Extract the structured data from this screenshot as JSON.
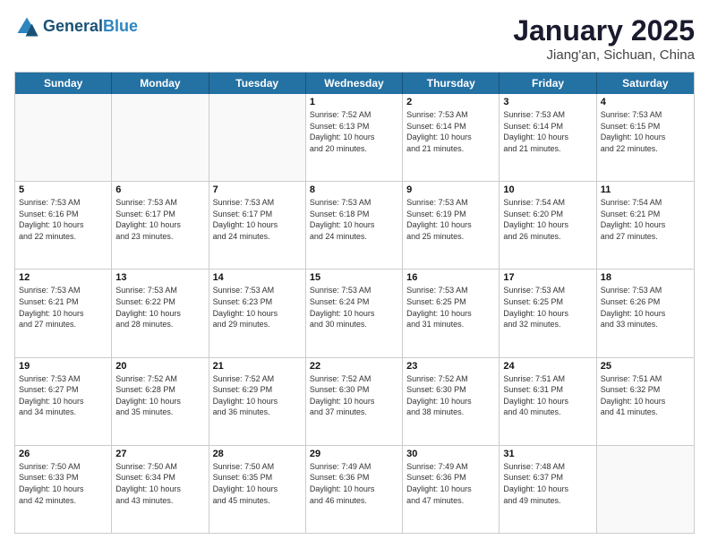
{
  "header": {
    "logo_general": "General",
    "logo_blue": "Blue",
    "title": "January 2025",
    "location": "Jiang'an, Sichuan, China"
  },
  "dayHeaders": [
    "Sunday",
    "Monday",
    "Tuesday",
    "Wednesday",
    "Thursday",
    "Friday",
    "Saturday"
  ],
  "weeks": [
    [
      {
        "day": "",
        "info": ""
      },
      {
        "day": "",
        "info": ""
      },
      {
        "day": "",
        "info": ""
      },
      {
        "day": "1",
        "info": "Sunrise: 7:52 AM\nSunset: 6:13 PM\nDaylight: 10 hours\nand 20 minutes."
      },
      {
        "day": "2",
        "info": "Sunrise: 7:53 AM\nSunset: 6:14 PM\nDaylight: 10 hours\nand 21 minutes."
      },
      {
        "day": "3",
        "info": "Sunrise: 7:53 AM\nSunset: 6:14 PM\nDaylight: 10 hours\nand 21 minutes."
      },
      {
        "day": "4",
        "info": "Sunrise: 7:53 AM\nSunset: 6:15 PM\nDaylight: 10 hours\nand 22 minutes."
      }
    ],
    [
      {
        "day": "5",
        "info": "Sunrise: 7:53 AM\nSunset: 6:16 PM\nDaylight: 10 hours\nand 22 minutes."
      },
      {
        "day": "6",
        "info": "Sunrise: 7:53 AM\nSunset: 6:17 PM\nDaylight: 10 hours\nand 23 minutes."
      },
      {
        "day": "7",
        "info": "Sunrise: 7:53 AM\nSunset: 6:17 PM\nDaylight: 10 hours\nand 24 minutes."
      },
      {
        "day": "8",
        "info": "Sunrise: 7:53 AM\nSunset: 6:18 PM\nDaylight: 10 hours\nand 24 minutes."
      },
      {
        "day": "9",
        "info": "Sunrise: 7:53 AM\nSunset: 6:19 PM\nDaylight: 10 hours\nand 25 minutes."
      },
      {
        "day": "10",
        "info": "Sunrise: 7:54 AM\nSunset: 6:20 PM\nDaylight: 10 hours\nand 26 minutes."
      },
      {
        "day": "11",
        "info": "Sunrise: 7:54 AM\nSunset: 6:21 PM\nDaylight: 10 hours\nand 27 minutes."
      }
    ],
    [
      {
        "day": "12",
        "info": "Sunrise: 7:53 AM\nSunset: 6:21 PM\nDaylight: 10 hours\nand 27 minutes."
      },
      {
        "day": "13",
        "info": "Sunrise: 7:53 AM\nSunset: 6:22 PM\nDaylight: 10 hours\nand 28 minutes."
      },
      {
        "day": "14",
        "info": "Sunrise: 7:53 AM\nSunset: 6:23 PM\nDaylight: 10 hours\nand 29 minutes."
      },
      {
        "day": "15",
        "info": "Sunrise: 7:53 AM\nSunset: 6:24 PM\nDaylight: 10 hours\nand 30 minutes."
      },
      {
        "day": "16",
        "info": "Sunrise: 7:53 AM\nSunset: 6:25 PM\nDaylight: 10 hours\nand 31 minutes."
      },
      {
        "day": "17",
        "info": "Sunrise: 7:53 AM\nSunset: 6:25 PM\nDaylight: 10 hours\nand 32 minutes."
      },
      {
        "day": "18",
        "info": "Sunrise: 7:53 AM\nSunset: 6:26 PM\nDaylight: 10 hours\nand 33 minutes."
      }
    ],
    [
      {
        "day": "19",
        "info": "Sunrise: 7:53 AM\nSunset: 6:27 PM\nDaylight: 10 hours\nand 34 minutes."
      },
      {
        "day": "20",
        "info": "Sunrise: 7:52 AM\nSunset: 6:28 PM\nDaylight: 10 hours\nand 35 minutes."
      },
      {
        "day": "21",
        "info": "Sunrise: 7:52 AM\nSunset: 6:29 PM\nDaylight: 10 hours\nand 36 minutes."
      },
      {
        "day": "22",
        "info": "Sunrise: 7:52 AM\nSunset: 6:30 PM\nDaylight: 10 hours\nand 37 minutes."
      },
      {
        "day": "23",
        "info": "Sunrise: 7:52 AM\nSunset: 6:30 PM\nDaylight: 10 hours\nand 38 minutes."
      },
      {
        "day": "24",
        "info": "Sunrise: 7:51 AM\nSunset: 6:31 PM\nDaylight: 10 hours\nand 40 minutes."
      },
      {
        "day": "25",
        "info": "Sunrise: 7:51 AM\nSunset: 6:32 PM\nDaylight: 10 hours\nand 41 minutes."
      }
    ],
    [
      {
        "day": "26",
        "info": "Sunrise: 7:50 AM\nSunset: 6:33 PM\nDaylight: 10 hours\nand 42 minutes."
      },
      {
        "day": "27",
        "info": "Sunrise: 7:50 AM\nSunset: 6:34 PM\nDaylight: 10 hours\nand 43 minutes."
      },
      {
        "day": "28",
        "info": "Sunrise: 7:50 AM\nSunset: 6:35 PM\nDaylight: 10 hours\nand 45 minutes."
      },
      {
        "day": "29",
        "info": "Sunrise: 7:49 AM\nSunset: 6:36 PM\nDaylight: 10 hours\nand 46 minutes."
      },
      {
        "day": "30",
        "info": "Sunrise: 7:49 AM\nSunset: 6:36 PM\nDaylight: 10 hours\nand 47 minutes."
      },
      {
        "day": "31",
        "info": "Sunrise: 7:48 AM\nSunset: 6:37 PM\nDaylight: 10 hours\nand 49 minutes."
      },
      {
        "day": "",
        "info": ""
      }
    ]
  ]
}
